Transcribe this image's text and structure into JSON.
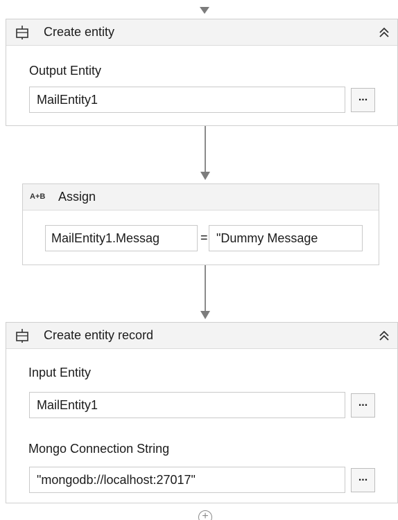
{
  "workflow": {
    "create_entity": {
      "title": "Create entity",
      "output_label": "Output Entity",
      "output_value": "MailEntity1",
      "ellipsis": "..."
    },
    "assign": {
      "icon_text": "A+B",
      "title": "Assign",
      "left_value": "MailEntity1.Messag",
      "operator": "=",
      "right_value": "\"Dummy Message"
    },
    "create_entity_record": {
      "title": "Create entity record",
      "input_label": "Input Entity",
      "input_value": "MailEntity1",
      "connection_label": "Mongo Connection String",
      "connection_value": "\"mongodb://localhost:27017\"",
      "ellipsis": "..."
    },
    "add_icon": "+"
  },
  "icons": {
    "entity": "entity-activity-icon",
    "collapse": "double-chevron-up-icon",
    "assign": "assign-activity-icon",
    "add": "add-activity-icon"
  },
  "colors": {
    "header_bg": "#f3f3f3",
    "border": "#cfcfcf",
    "connector": "#8a8a8a"
  }
}
